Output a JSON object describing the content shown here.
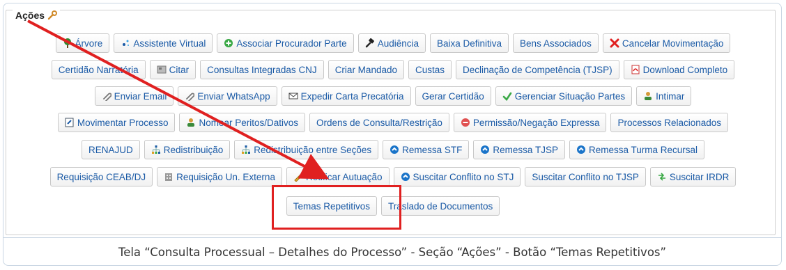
{
  "section": {
    "title": "Ações"
  },
  "rows": [
    [
      "Árvore",
      "Assistente Virtual",
      "Associar Procurador Parte",
      "Audiência",
      "Baixa Definitiva",
      "Bens Associados",
      "Cancelar Movimentação"
    ],
    [
      "Certidão Narratória",
      "Citar",
      "Consultas Integradas CNJ",
      "Criar Mandado",
      "Custas",
      "Declinação de Competência (TJSP)",
      "Download Completo"
    ],
    [
      "Enviar Email",
      "Enviar WhatsApp",
      "Expedir Carta Precatória",
      "Gerar Certidão",
      "Gerenciar Situação Partes",
      "Intimar"
    ],
    [
      "Movimentar Processo",
      "Nomear Peritos/Dativos",
      "Ordens de Consulta/Restrição",
      "Permissão/Negação Expressa",
      "Processos Relacionados"
    ],
    [
      "RENAJUD",
      "Redistribuição",
      "Redistribuição entre Seções",
      "Remessa STF",
      "Remessa TJSP",
      "Remessa Turma Recursal"
    ],
    [
      "Requisição CEAB/DJ",
      "Requisição Un. Externa",
      "Retificar Autuação",
      "Suscitar Conflito no STJ",
      "Suscitar Conflito no TJSP",
      "Suscitar IRDR"
    ],
    [
      "Temas Repetitivos",
      "Traslado de Documentos"
    ]
  ],
  "icons": [
    [
      "tree-icon",
      "assistant-sparkle-icon",
      "add-circle-icon",
      "gavel-icon",
      "",
      "",
      "cancel-x-icon"
    ],
    [
      "",
      "newspaper-icon",
      "",
      "",
      "",
      "",
      "pdf-icon"
    ],
    [
      "paperclip-icon",
      "paperclip-icon",
      "envelope-icon",
      "",
      "check-icon",
      "users-icon"
    ],
    [
      "move-document-icon",
      "users-icon",
      "",
      "stop-circle-icon",
      ""
    ],
    [
      "",
      "sitemap-icon",
      "sitemap-icon",
      "up-circle-icon",
      "up-circle-icon",
      "up-circle-icon"
    ],
    [
      "",
      "building-icon",
      "pencil-icon",
      "up-circle-icon",
      "",
      "irdr-arrows-icon"
    ],
    [
      "",
      ""
    ]
  ],
  "caption": "Tela “Consulta Processual – Detalhes do Processo” - Seção “Ações” - Botão “Temas Repetitivos”",
  "colors": {
    "link": "#1a5aa6",
    "highlight": "#e02020",
    "cancel": "#e02020"
  }
}
